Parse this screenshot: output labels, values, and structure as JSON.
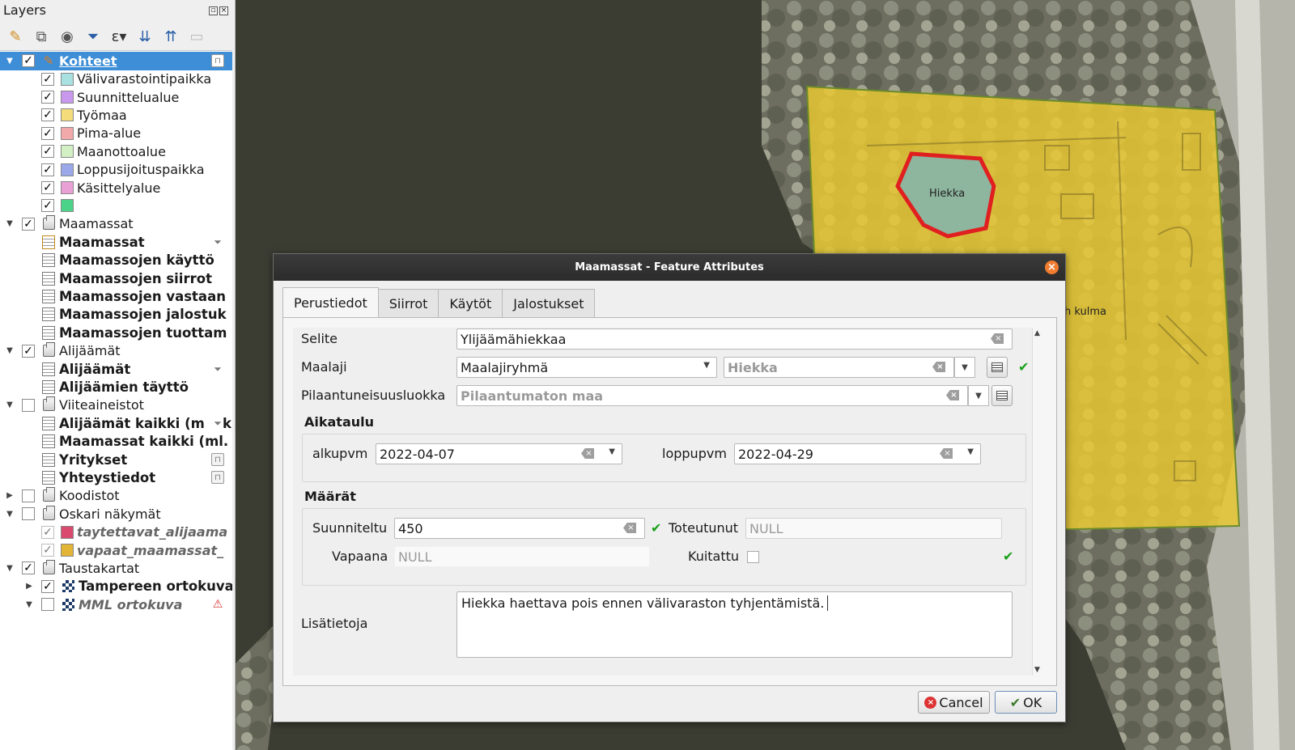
{
  "layers_panel": {
    "title": "Layers",
    "toolbar_icons": [
      "paint-brush-icon",
      "add-group-icon",
      "eye-icon",
      "filter-icon",
      "expression-icon",
      "expand-all-icon",
      "collapse-all-icon",
      "remove-layer-icon"
    ],
    "items": [
      {
        "label": "Kohteet",
        "level": 0,
        "expanded": true,
        "checked": true,
        "icon": "edit-vector-icon",
        "style": "link",
        "selected": true,
        "right_icon": "lock-icon"
      },
      {
        "label": "Välivarastointipaikka",
        "level": 2,
        "checked": true,
        "swatch": "#a9e0e0"
      },
      {
        "label": "Suunnittelualue",
        "level": 2,
        "checked": true,
        "swatch": "#c898ec"
      },
      {
        "label": "Työmaa",
        "level": 2,
        "checked": true,
        "swatch": "#f4dc7b"
      },
      {
        "label": "Pima-alue",
        "level": 2,
        "checked": true,
        "swatch": "#f2a9a9"
      },
      {
        "label": "Maanottoalue",
        "level": 2,
        "checked": true,
        "swatch": "#d2f0c4"
      },
      {
        "label": "Loppusijoituspaikka",
        "level": 2,
        "checked": true,
        "swatch": "#9aa8ea"
      },
      {
        "label": "Käsittelyalue",
        "level": 2,
        "checked": true,
        "swatch": "#e9a0d4"
      },
      {
        "label": "",
        "level": 2,
        "checked": true,
        "swatch": "#4cd38a"
      },
      {
        "label": "Maamassat",
        "level": 0,
        "expanded": true,
        "checked": true,
        "icon": "group-icon"
      },
      {
        "label": "Maamassat",
        "level": 1,
        "icon": "edit-table-icon",
        "style": "bold",
        "right_icon": "filter-icon"
      },
      {
        "label": "Maamassojen käyttö",
        "level": 1,
        "icon": "table-icon",
        "style": "bold"
      },
      {
        "label": "Maamassojen siirrot",
        "level": 1,
        "icon": "table-icon",
        "style": "bold"
      },
      {
        "label": "Maamassojen vastaan",
        "level": 1,
        "icon": "table-icon",
        "style": "bold"
      },
      {
        "label": "Maamassojen jalostuk",
        "level": 1,
        "icon": "table-icon",
        "style": "bold"
      },
      {
        "label": "Maamassojen tuottam",
        "level": 1,
        "icon": "table-icon",
        "style": "bold"
      },
      {
        "label": "Alijäämät",
        "level": 0,
        "expanded": true,
        "checked": true,
        "icon": "group-icon"
      },
      {
        "label": "Alijäämät",
        "level": 1,
        "icon": "table-icon",
        "style": "bold",
        "right_icon": "filter-icon"
      },
      {
        "label": "Alijäämien täyttö",
        "level": 1,
        "icon": "table-icon",
        "style": "bold"
      },
      {
        "label": "Viiteaineistot",
        "level": 0,
        "expanded": true,
        "checked": false,
        "icon": "group-icon"
      },
      {
        "label": "Alijäämät kaikki (m",
        "level": 1,
        "icon": "table-icon",
        "style": "bold",
        "right_icon": "filter-icon",
        "suffix": "k"
      },
      {
        "label": "Maamassat kaikki (ml.",
        "level": 1,
        "icon": "table-icon",
        "style": "bold"
      },
      {
        "label": "Yritykset",
        "level": 1,
        "icon": "table-icon",
        "style": "bold",
        "right_icon": "lock-icon"
      },
      {
        "label": "Yhteystiedot",
        "level": 1,
        "icon": "table-icon",
        "style": "bold",
        "right_icon": "lock-icon"
      },
      {
        "label": "Koodistot",
        "level": 0,
        "expanded": false,
        "checked": false,
        "icon": "group-icon"
      },
      {
        "label": "Oskari näkymät",
        "level": 0,
        "expanded": true,
        "checked": false,
        "icon": "group-icon"
      },
      {
        "label": "taytettavat_alijaama",
        "level": 2,
        "checked": true,
        "dim": true,
        "swatch": "#d94a6e",
        "style": "italic"
      },
      {
        "label": "vapaat_maamassat_",
        "level": 2,
        "checked": true,
        "dim": true,
        "swatch": "#e2b537",
        "style": "italic"
      },
      {
        "label": "Taustakartat",
        "level": 0,
        "expanded": true,
        "checked": true,
        "icon": "group-icon"
      },
      {
        "label": "Tampereen ortokuva",
        "level": 1,
        "expanded": false,
        "checked": true,
        "icon": "raster-icon",
        "style": "bold"
      },
      {
        "label": "MML ortokuva",
        "level": 1,
        "expanded": true,
        "checked": false,
        "icon": "raster-icon",
        "style": "italic",
        "right_icon": "warning-icon"
      }
    ]
  },
  "map": {
    "feature_label": "Hiekka",
    "partial_label": "h kulma",
    "area_fill": "#e8c832",
    "feature_outline": "#e02020"
  },
  "dialog": {
    "title": "Maamassat - Feature Attributes",
    "tabs": [
      "Perustiedot",
      "Siirrot",
      "Käytöt",
      "Jalostukset"
    ],
    "active_tab": 0,
    "fields": {
      "selite_label": "Selite",
      "selite_value": "Ylijäämähiekkaa",
      "maalaji_label": "Maalaji",
      "maalaji_group": "Maalajiryhmä",
      "maalaji_value": "Hiekka",
      "pilaantuneisuus_label": "Pilaantuneisuusluokka",
      "pilaantuneisuus_value": "Pilaantumaton maa"
    },
    "aikataulu": {
      "title": "Aikataulu",
      "alku_label": "alkupvm",
      "alku_value": "2022-04-07",
      "loppu_label": "loppupvm",
      "loppu_value": "2022-04-29"
    },
    "maarat": {
      "title": "Määrät",
      "suunniteltu_label": "Suunniteltu",
      "suunniteltu_value": "450",
      "toteutunut_label": "Toteutunut",
      "toteutunut_value": "NULL",
      "vapaana_label": "Vapaana",
      "vapaana_value": "NULL",
      "kuitattu_label": "Kuitattu",
      "kuitattu_checked": false
    },
    "lisatietoja_label": "Lisätietoja",
    "lisatietoja_value": "Hiekka haettava pois ennen välivaraston tyhjentämistä.",
    "cancel_label": "Cancel",
    "ok_label": "OK",
    "valid_color": "#18a018"
  }
}
